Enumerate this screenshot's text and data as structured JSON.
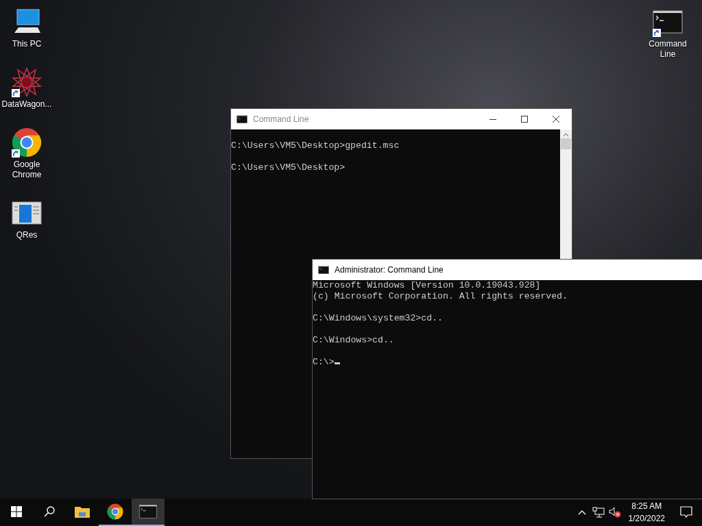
{
  "desktop_icons": [
    {
      "label": "This PC",
      "kind": "pc",
      "shortcut": false
    },
    {
      "label": "DataWagon...",
      "kind": "star",
      "shortcut": true
    },
    {
      "label": "Google Chrome",
      "kind": "chrome",
      "shortcut": true
    },
    {
      "label": "QRes",
      "kind": "qres",
      "shortcut": false
    }
  ],
  "corner_icon": {
    "label": "Command Line",
    "kind": "console",
    "shortcut": true
  },
  "windows": [
    {
      "title": "Command Line",
      "active": false,
      "controls": true,
      "scrollbar": true,
      "cursor": false,
      "blocks": [
        [
          "C:\\Users\\VM5\\Desktop>gpedit.msc"
        ],
        [
          "C:\\Users\\VM5\\Desktop>"
        ]
      ]
    },
    {
      "title": "Administrator: Command Line",
      "active": true,
      "controls": false,
      "scrollbar": false,
      "cursor": true,
      "blocks": [
        [
          "Microsoft Windows [Version 10.0.19043.928]",
          "(c) Microsoft Corporation. All rights reserved."
        ],
        [
          "C:\\Windows\\system32>cd.."
        ],
        [
          "C:\\Windows>cd.."
        ],
        [
          "C:\\>"
        ]
      ]
    }
  ],
  "taskbar": {
    "items": [
      {
        "kind": "start",
        "running": false,
        "selected": false
      },
      {
        "kind": "search",
        "running": false,
        "selected": false
      },
      {
        "kind": "explorer",
        "running": false,
        "selected": false
      },
      {
        "kind": "chrome",
        "running": true,
        "selected": false
      },
      {
        "kind": "console",
        "running": true,
        "selected": true
      }
    ],
    "tray": [
      {
        "kind": "chevron"
      },
      {
        "kind": "network"
      },
      {
        "kind": "volume-muted"
      }
    ],
    "clock": {
      "time": "8:25 AM",
      "date": "1/20/2022"
    }
  }
}
